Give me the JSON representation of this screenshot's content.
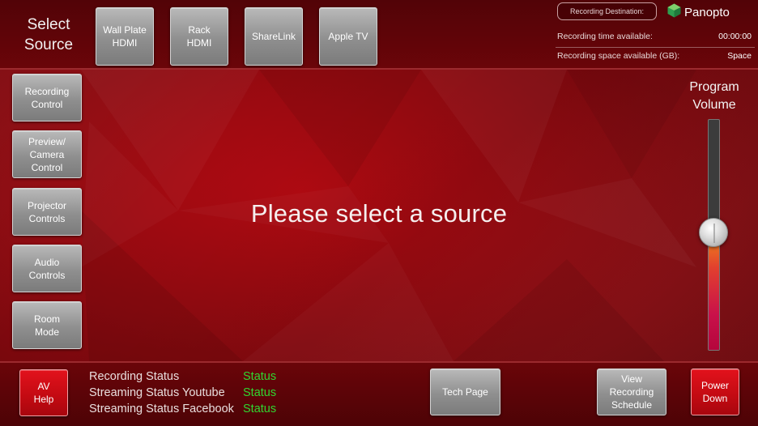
{
  "header": {
    "select_source": "Select\nSource",
    "sources": [
      {
        "label": "Wall Plate\nHDMI"
      },
      {
        "label": "Rack\nHDMI"
      },
      {
        "label": "ShareLink"
      },
      {
        "label": "Apple TV"
      }
    ],
    "recording_destination": "Recording Destination:",
    "brand": "Panopto",
    "recording_time_label": "Recording time available:",
    "recording_time_value": "00:00:00",
    "recording_space_label": "Recording space available (GB):",
    "recording_space_value": "Space"
  },
  "sidebar": {
    "items": [
      {
        "label": "Recording\nControl"
      },
      {
        "label": "Preview/\nCamera\nControl"
      },
      {
        "label": "Projector\nControls"
      },
      {
        "label": "Audio\nControls"
      },
      {
        "label": "Room\nMode"
      }
    ]
  },
  "main": {
    "message": "Please select a source"
  },
  "volume": {
    "title": "Program\nVolume",
    "level": 0.51
  },
  "footer": {
    "av_help": "AV\nHelp",
    "statuses": [
      {
        "label": "Recording Status",
        "value": "Status"
      },
      {
        "label": "Streaming Status Youtube",
        "value": "Status"
      },
      {
        "label": "Streaming Status Facebook",
        "value": "Status"
      }
    ],
    "tech_page": "Tech Page",
    "view_schedule": "View\nRecording\nSchedule",
    "power_down": "Power\nDown"
  },
  "colors": {
    "background_red": "#a00a10",
    "status_green": "#30d630",
    "button_red": "#d40f18",
    "button_gray": "#9a9a9a"
  },
  "icons": {
    "brand_logo": "panopto-logo-icon",
    "volume_knob": "slider-knob-icon"
  }
}
